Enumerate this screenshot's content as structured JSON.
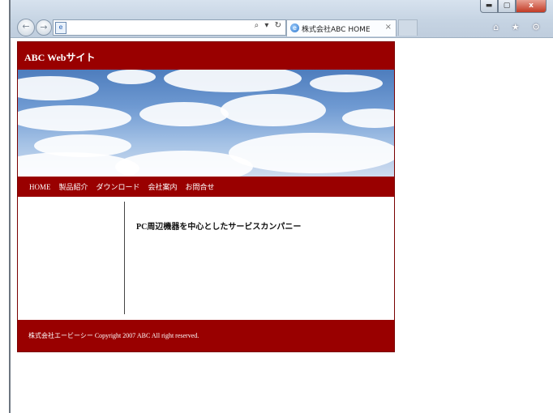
{
  "browser": {
    "window_controls": {
      "minimize": "▬",
      "maximize": "▢",
      "close": "x"
    },
    "back_glyph": "←",
    "forward_glyph": "→",
    "address": {
      "value": "",
      "tools": "⌕ ▾ ↻"
    },
    "tab": {
      "title": "株式会社ABC HOME",
      "close": "×"
    },
    "toolbar_icons": "⌂ ★ ⚙"
  },
  "site": {
    "title": "ABC Webサイト",
    "nav": [
      "HOME",
      "製品紹介",
      "ダウンロード",
      "会社案内",
      "お問合せ"
    ],
    "headline": "PC周辺機器を中心としたサービスカンパニー",
    "footer": "株式会社エービーシー  Copyright 2007 ABC All right reserved.",
    "colors": {
      "brand": "#990000",
      "sky": "#6f9ad2"
    }
  }
}
